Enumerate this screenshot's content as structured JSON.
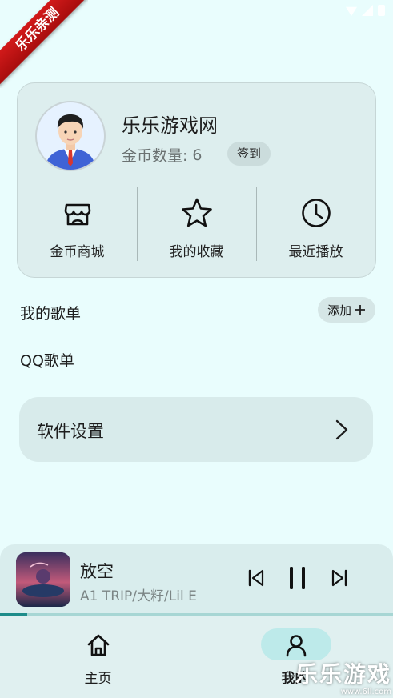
{
  "ribbon": {
    "text": "乐乐亲测"
  },
  "profile": {
    "username": "乐乐游戏网",
    "coins_label": "金币数量:",
    "coins_value": "6",
    "checkin_label": "签到"
  },
  "quick_actions": [
    {
      "label": "金币商城",
      "icon": "store-icon"
    },
    {
      "label": "我的收藏",
      "icon": "star-icon"
    },
    {
      "label": "最近播放",
      "icon": "clock-icon"
    }
  ],
  "playlists_section": {
    "title": "我的歌单",
    "add_label": "添加",
    "items": [
      {
        "label": "QQ歌单"
      }
    ]
  },
  "settings": {
    "label": "软件设置"
  },
  "player": {
    "title": "放空",
    "artist": "A1 TRIP/大籽/Lil E",
    "progress": 0.07
  },
  "nav": [
    {
      "label": "主页",
      "icon": "home-icon",
      "active": false
    },
    {
      "label": "我的",
      "icon": "person-icon",
      "active": true
    }
  ],
  "watermark": {
    "text": "乐乐游戏",
    "url": "www.6ll.com"
  },
  "colors": {
    "background": "#e9fdfd",
    "accent": "#1e8c8a",
    "ribbon": "#c41515"
  }
}
